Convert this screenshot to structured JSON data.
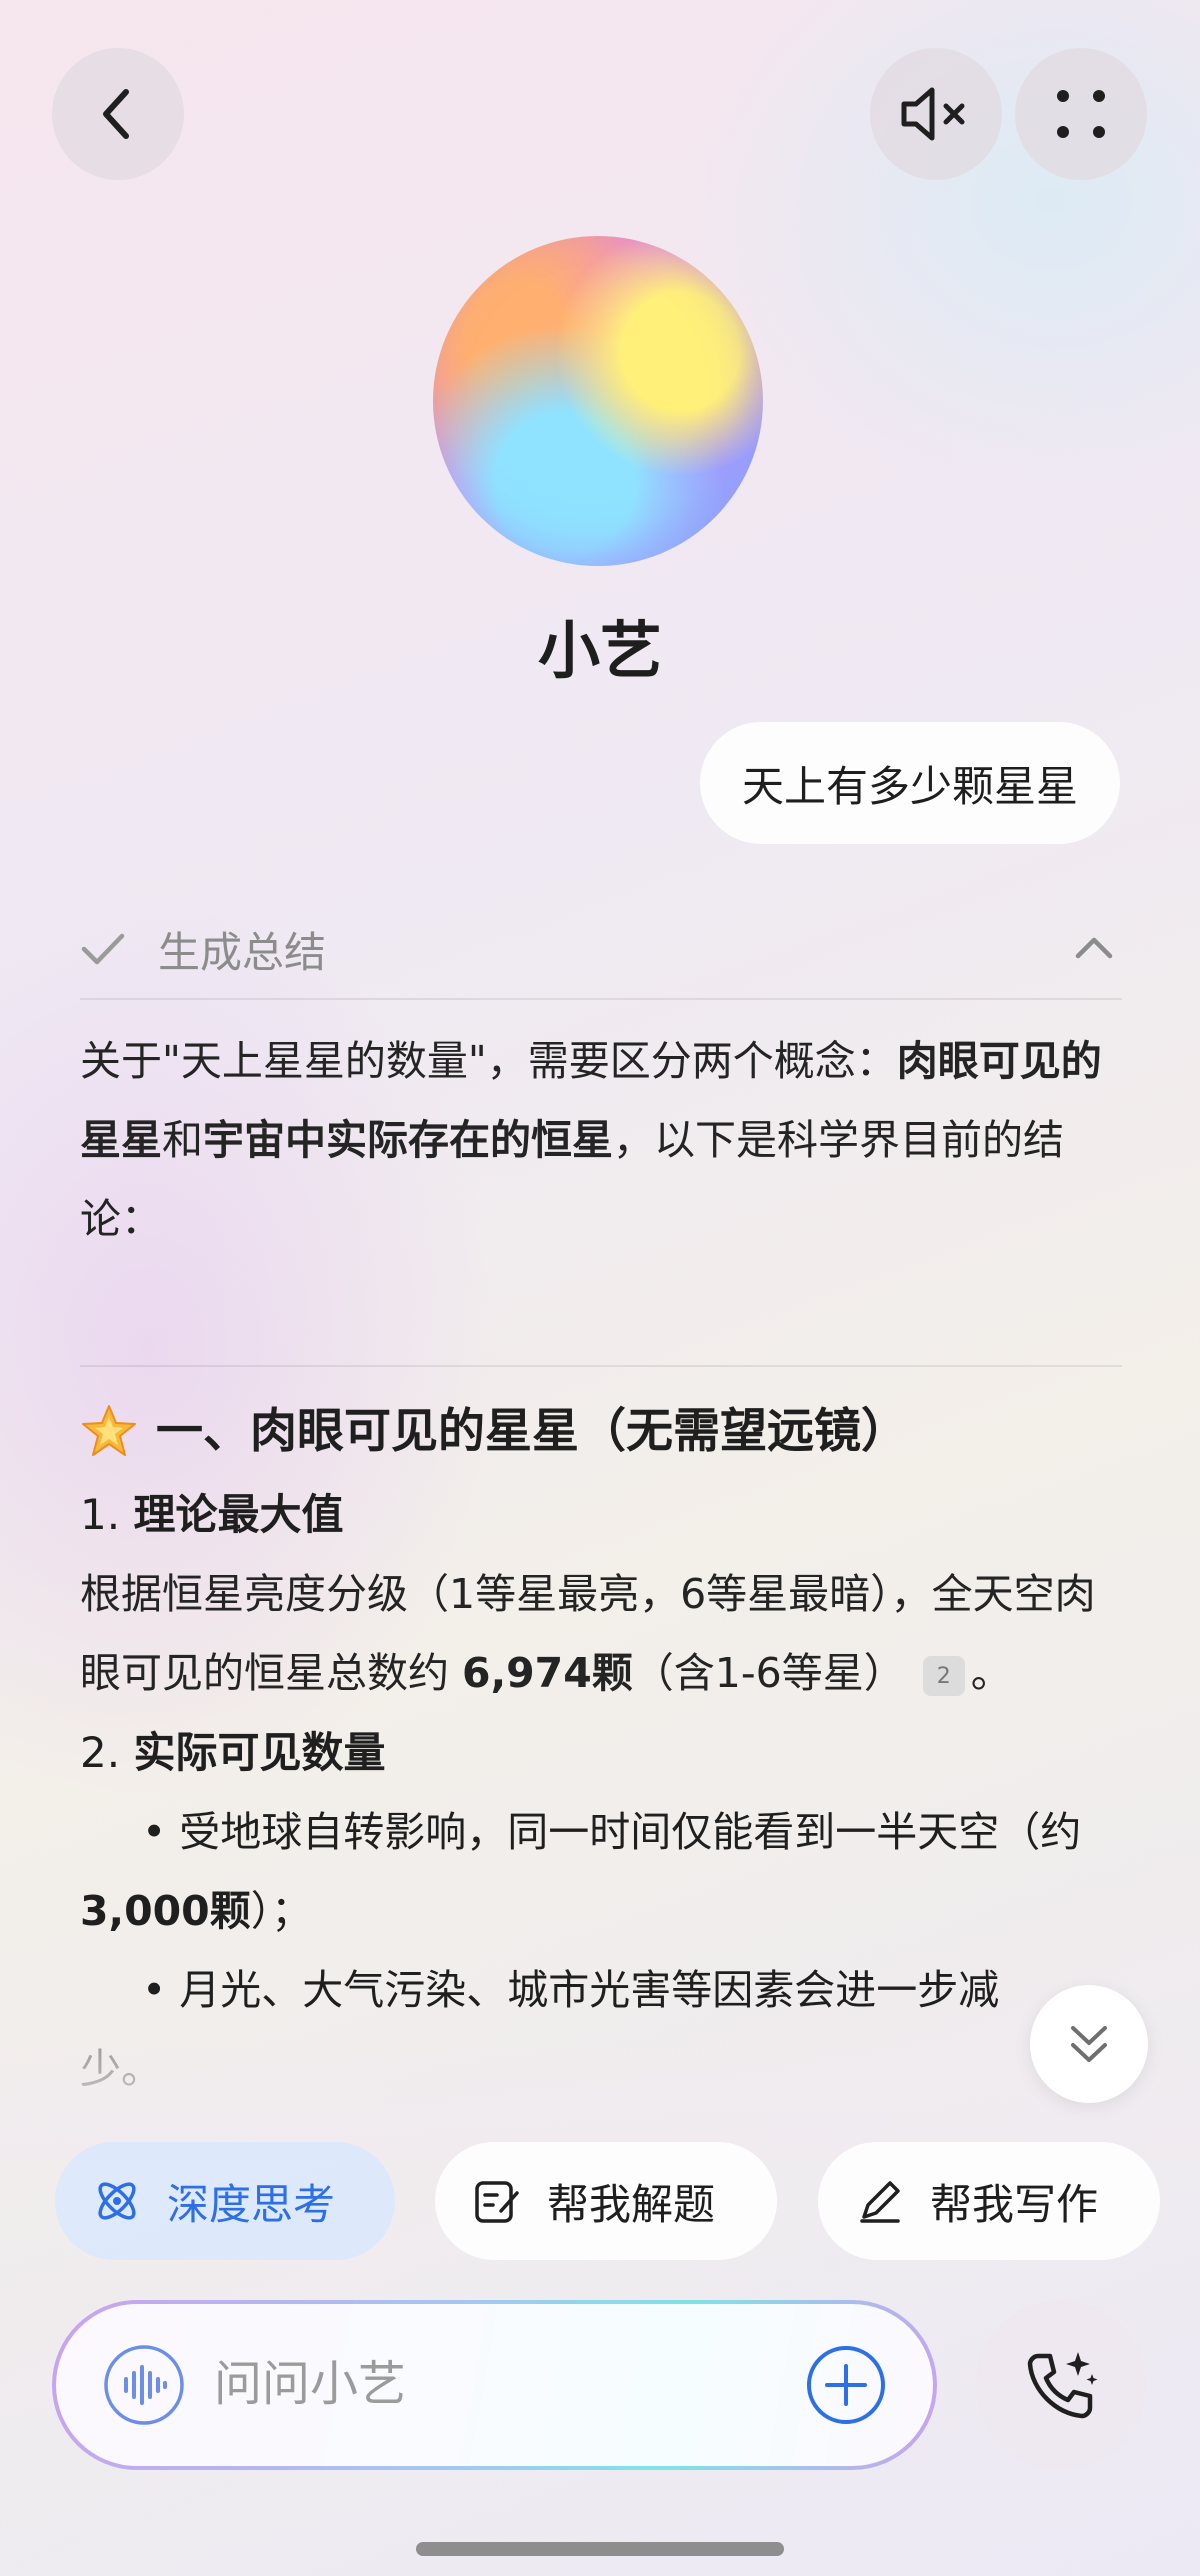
{
  "assistant": {
    "name": "小艺"
  },
  "user_message": "天上有多少颗星星",
  "summary": {
    "label": "生成总结"
  },
  "intro": {
    "p1": "关于\"天上星星的数量\"，需要区分两个概念：",
    "b1": "肉眼可见的星星",
    "p2": "和",
    "b2": "宇宙中实际存在的恒星",
    "p3": "，以下是科学界目前的结论："
  },
  "section1": {
    "title": "一、肉眼可见的星星（无需望远镜）",
    "item1_num": "1. ",
    "item1_title": "理论最大值",
    "item1_text_a": "根据恒星亮度分级（1等星最亮，6等星最暗），全天空肉眼可见的恒星总数约 ",
    "item1_bold": "6,974颗",
    "item1_text_b": "（含1-6等星）",
    "item1_cite": "2",
    "item1_end": "。",
    "item2_num": "2. ",
    "item2_title": "实际可见数量",
    "bullet1_a": "• 受地球自转影响，同一时间仅能看到一半天空（约 ",
    "bullet1_bold": "3,000颗",
    "bullet1_b": "）；",
    "bullet2": "• 月光、大气污染、城市光害等因素会进一步减",
    "bullet2_tail": "少。"
  },
  "chips": {
    "deep_think": "深度思考",
    "solve": "帮我解题",
    "write": "帮我写作"
  },
  "input": {
    "placeholder": "问问小艺"
  },
  "colors": {
    "accent_blue": "#2c6fe6",
    "star_yellow": "#f6b93b"
  }
}
